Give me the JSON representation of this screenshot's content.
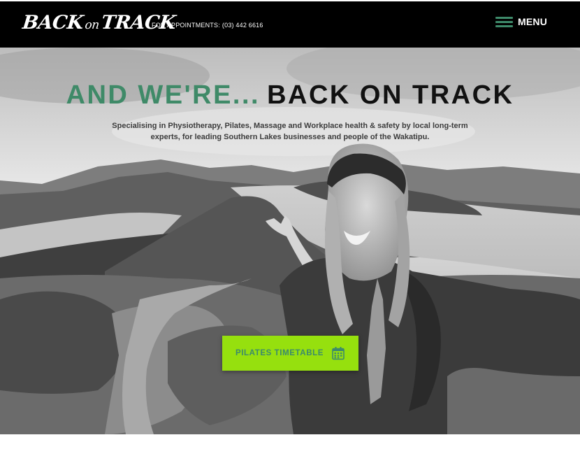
{
  "header": {
    "logo": {
      "part1": "BACK",
      "part2": "on",
      "part3": "TRACK"
    },
    "appointments_label": "FOR APPOINTMENTS:",
    "appointments_phone": "(03) 442 6616",
    "menu_label": "MENU",
    "menu_icon": "hamburger-icon"
  },
  "hero": {
    "headline_accent": "AND WE'RE...",
    "headline_main": "BACK ON TRACK",
    "subline": "Specialising in Physiotherapy, Pilates, Massage and Workplace health & safety by local long-term experts, for leading Southern Lakes businesses and people of the Wakatipu.",
    "cta_label": "PILATES TIMETABLE",
    "cta_icon": "calendar-icon"
  },
  "colors": {
    "header_bg": "#000000",
    "accent_green": "#3f8a68",
    "cta_bg": "#96e00e"
  }
}
